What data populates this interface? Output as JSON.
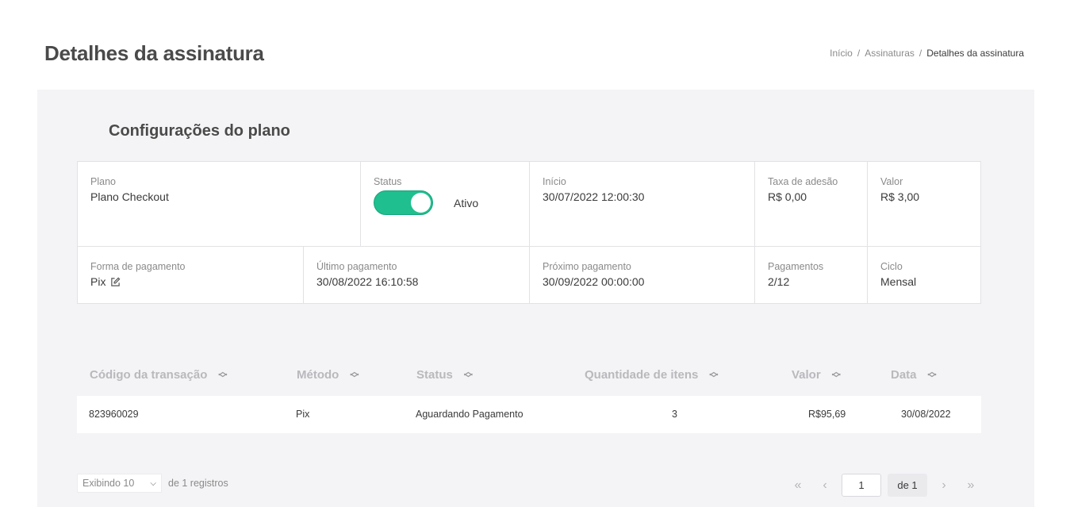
{
  "header": {
    "title": "Detalhes da assinatura",
    "breadcrumb": [
      "Início",
      "Assinaturas",
      "Detalhes da assinatura"
    ],
    "breadcrumb_separator": "/"
  },
  "config": {
    "title": "Configurações do plano",
    "plano": {
      "label": "Plano",
      "value": "Plano Checkout"
    },
    "status": {
      "label": "Status",
      "value": "Ativo",
      "enabled": true
    },
    "inicio": {
      "label": "Início",
      "value": "30/07/2022 12:00:30"
    },
    "taxa": {
      "label": "Taxa de adesão",
      "value": "R$ 0,00"
    },
    "valor": {
      "label": "Valor",
      "value": "R$ 3,00"
    },
    "forma": {
      "label": "Forma de pagamento",
      "value": "Pix"
    },
    "ultimo": {
      "label": "Último pagamento",
      "value": "30/08/2022 16:10:58"
    },
    "proximo": {
      "label": "Próximo pagamento",
      "value": "30/09/2022 00:00:00"
    },
    "pagamentos": {
      "label": "Pagamentos",
      "value": "2/12"
    },
    "ciclo": {
      "label": "Ciclo",
      "value": "Mensal"
    }
  },
  "colors": {
    "accent": "#1fbf8f",
    "panel": "#f4f4f6"
  },
  "table": {
    "columns": [
      "Código da transação",
      "Método",
      "Status",
      "Quantidade de itens",
      "Valor",
      "Data"
    ],
    "rows": [
      {
        "codigo": "823960029",
        "metodo": "Pix",
        "status": "Aguardando Pagamento",
        "quantidade": "3",
        "valor": "R$95,69",
        "data": "30/08/2022"
      }
    ]
  },
  "footer": {
    "showing": "Exibindo 10",
    "records": "de 1 registros",
    "page": "1",
    "of": "de 1"
  }
}
